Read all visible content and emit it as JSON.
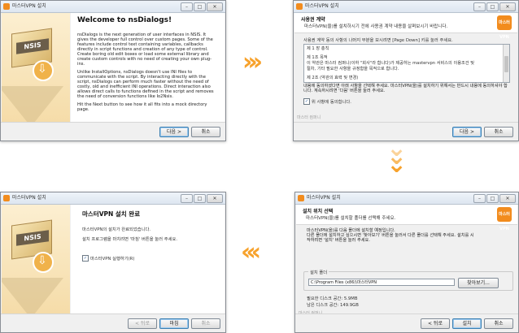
{
  "windows": {
    "welcome": {
      "title": "마스터VPN 설치",
      "heading": "Welcome to nsDialogs!",
      "paragraphs": [
        "nsDialogs is the next generation of user interfaces in NSIS. It gives the developer full control over custom pages. Some of the features include control text containing variables, callbacks directly in script functions and creation of any type of control. Create boring old edit boxes or load some external library and create custom controls with no need of creating your own plug-ins.",
        "Unlike InstallOptions, nsDialogs doesn't use INI files to communicate with the script. By interacting directly with the script, nsDialogs can perform much faster without the need of costly, old and inefficient INI operations. Direct interaction also allows direct calls to functions defined in the script and removes the need of conversion functions like Io2Nsis.",
        "Hit the Next button to see how it all fits into a mock directory page."
      ],
      "box_label": "NSIS",
      "buttons": {
        "next": "다음 >",
        "cancel": "취소"
      }
    },
    "license": {
      "title": "마스터VPN 설치",
      "header_title": "사용권 계약",
      "header_sub": "마스터VPN(을)를 설치하시기 전에 사용권 계약 내용을 살펴보시기 바랍니다.",
      "logo": "마스터VPN",
      "instruction": "사용권 계약 동의 사항의 나머지 부분을 보시려면 [Page Down] 키를 눌러 주세요.",
      "license_lines": [
        "제 1 장 총칙",
        "",
        "제 1조 목적",
        "이 약관은 마스터 컴퍼니(이하 \"회사\"라 합니다)가 제공하는 mastervpn 서비스의 이용조건 및",
        "절차, 기타 필요한 사항을 규정함을 목적으로 합니다.",
        "",
        "제 2조 (약관의 효력 및 변경)"
      ],
      "agree_desc": "내용에 동의하셨다면 아래 사항을 선택해 주세요. 마스터VPN(을)를 설치하기 위해서는 반드시 내용에 동의하셔야 합니다. 계속하시려면 '다음' 버튼을 눌러 주세요.",
      "agree_label": "위 사항에 동의합니다.",
      "brand": "마스터 컴퍼니",
      "buttons": {
        "next": "다음 >",
        "cancel": "취소"
      }
    },
    "directory": {
      "title": "마스터VPN 설치",
      "header_title": "설치 위치 선택",
      "header_sub": "마스터VPN(을)를 설치할 폴더를 선택해 주세요.",
      "logo": "마스터VPN",
      "desc_lines": [
        "마스터VPN(을)를 다음 폴더에 설치할 예정입니다.",
        "다른 폴더에 설치하고 싶으시면 '찾아보기' 버튼을 눌러서 다른 폴더를 선택해 주세요. 설치를 시",
        "작하려면 '설치' 버튼을 눌러 주세요."
      ],
      "group_label": "설치 폴더",
      "path_value": "C:\\Program Files (x86)\\마스터VPN",
      "browse": "찾아보기...",
      "space_required": "필요한 디스크 공간: 5.9MB",
      "space_available": "남은 디스크 공간: 149.9GB",
      "brand": "마스터 컴퍼니",
      "buttons": {
        "back": "< 뒤로",
        "install": "설치",
        "cancel": "취소"
      }
    },
    "finish": {
      "title": "마스터VPN 설치",
      "heading": "마스터VPN 설치 완료",
      "lines": [
        "마스터VPN의 설치가 완료되었습니다.",
        "설치 프로그램을 마치려면 '마침' 버튼을 눌러 주세요."
      ],
      "run_label": "마스터VPN 실행하기(R)",
      "box_label": "NSIS",
      "buttons": {
        "back": "< 뒤로",
        "finish": "마침",
        "cancel": "취소"
      }
    }
  },
  "arrows": {
    "right": "›››",
    "down": "⌄",
    "left": "‹‹‹"
  },
  "colors": {
    "accent": "#f28c1e",
    "arrow": "#f7a22c"
  }
}
